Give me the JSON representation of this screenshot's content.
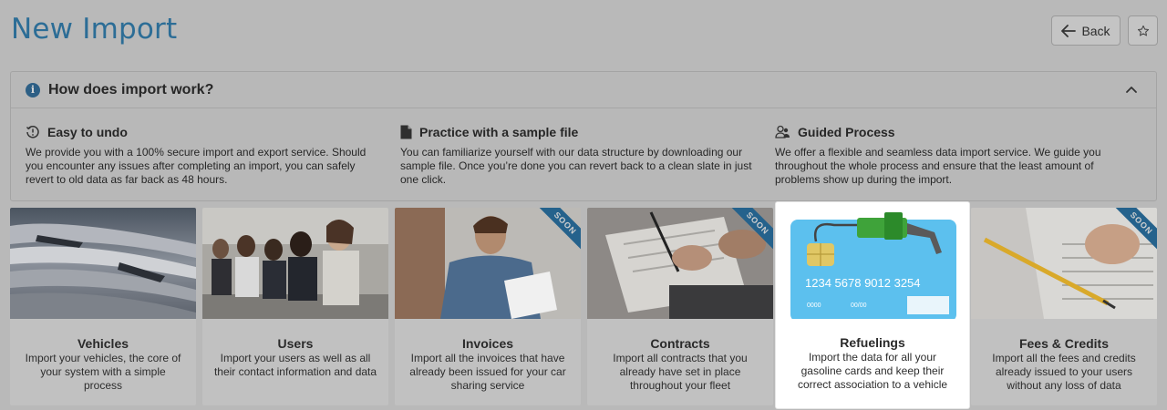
{
  "page": {
    "title": "New Import"
  },
  "header": {
    "back_label": "Back",
    "back_icon": "arrow-left-icon",
    "favorite_icon": "star-icon"
  },
  "info": {
    "title": "How does import work?",
    "features": [
      {
        "icon": "undo-clock-icon",
        "title": "Easy to undo",
        "description": "We provide you with a 100% secure import and export service. Should you encounter any issues after completing an import, you can safely revert to old data as far back as 48 hours."
      },
      {
        "icon": "document-icon",
        "title": "Practice with a sample file",
        "description": "You can familiarize yourself with our data structure by downloading our sample file. Once you’re done you can revert back to a clean slate in just one click."
      },
      {
        "icon": "users-icon",
        "title": "Guided Process",
        "description": "We offer a flexible and seamless data import service. We guide you throughout the whole process and ensure that the least amount of problems show up during the import."
      }
    ]
  },
  "cards": [
    {
      "title": "Vehicles",
      "description": "Import your vehicles, the core of your system with a simple process",
      "soon": false,
      "active": false
    },
    {
      "title": "Users",
      "description": "Import your users as well as all their contact information and data",
      "soon": false,
      "active": false
    },
    {
      "title": "Invoices",
      "description": "Import all the invoices that have already been issued for your car sharing service",
      "soon": true,
      "active": false
    },
    {
      "title": "Contracts",
      "description": "Import all contracts that you already have set in place throughout your fleet",
      "soon": true,
      "active": false
    },
    {
      "title": "Refuelings",
      "description": "Import the data for all your gasoline cards and keep their correct association to a vehicle",
      "soon": false,
      "active": true,
      "card_number": "1234  5678  9012  3254",
      "card_small_1": "0000",
      "card_small_2": "00/00"
    },
    {
      "title": "Fees & Credits",
      "description": "Import all the fees and credits already issued to your users without any loss of data",
      "soon": true,
      "active": false
    }
  ],
  "soon_label": "SOON"
}
